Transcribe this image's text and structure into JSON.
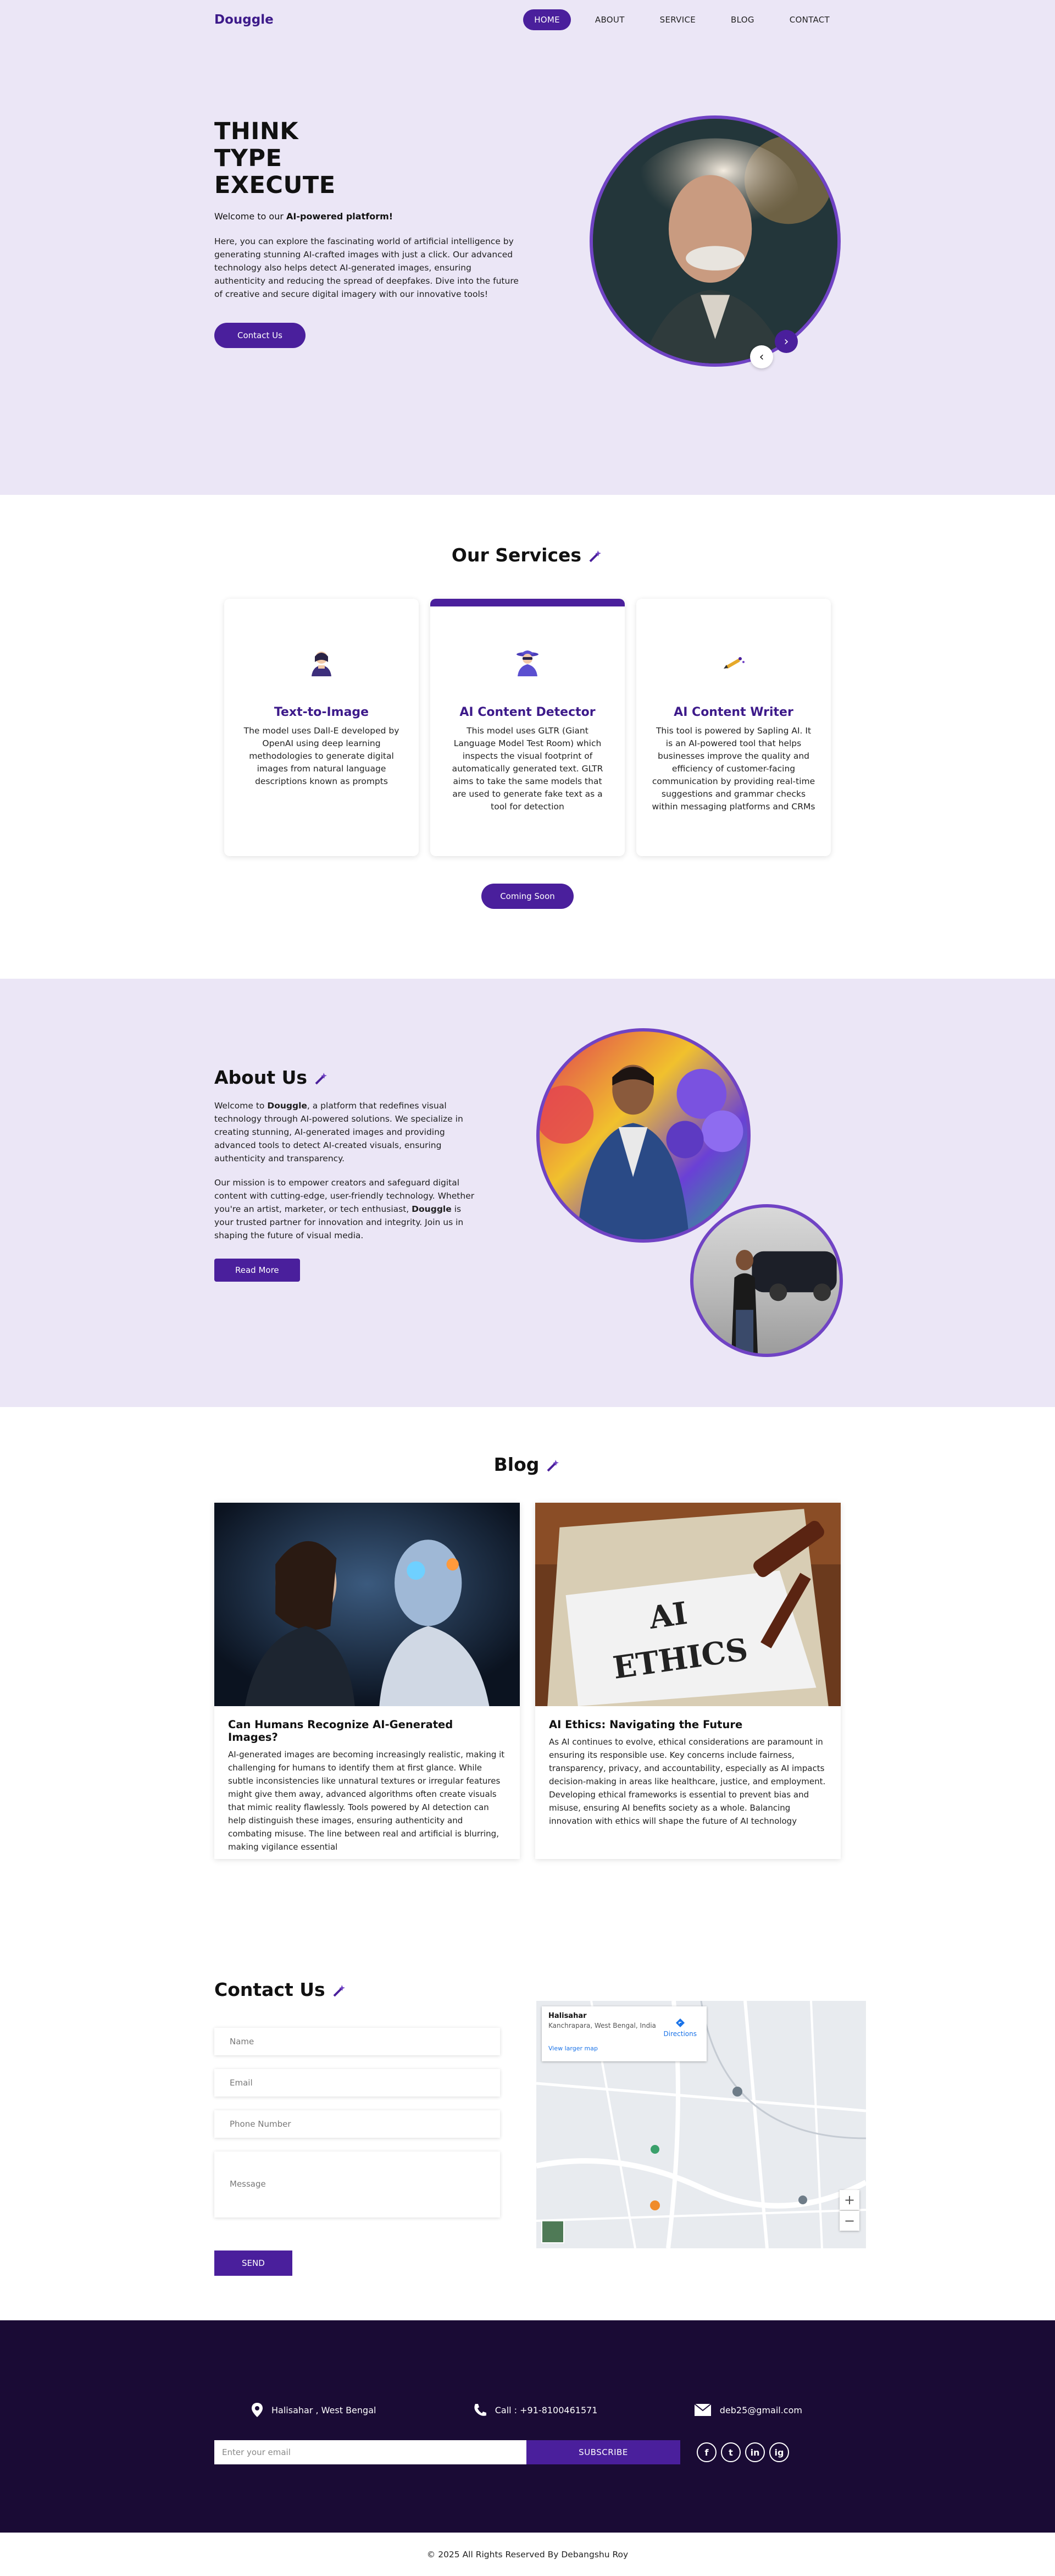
{
  "brand": "Douggle",
  "nav": {
    "items": [
      "HOME",
      "ABOUT",
      "SERVICE",
      "BLOG",
      "CONTACT"
    ],
    "active": "HOME"
  },
  "hero": {
    "title_line1": "THINK",
    "title_line2": "TYPE",
    "title_line3": "EXECUTE",
    "welcome_prefix": "Welcome to our",
    "welcome_bold": "AI-powered platform!",
    "description": "Here, you can explore the fascinating world of artificial intelligence by generating stunning AI-crafted images with just a click. Our advanced technology also helps detect AI-generated images, ensuring authenticity and reducing the spread of deepfakes. Dive into the future of creative and secure digital imagery with our innovative tools!",
    "cta": "Contact Us",
    "prev_glyph": "‹",
    "next_glyph": "›"
  },
  "services": {
    "title": "Our Services",
    "cards": [
      {
        "title": "Text-to-Image",
        "desc": "The model uses Dall-E developed by OpenAI using deep learning methodologies to generate digital images from natural language descriptions known as prompts"
      },
      {
        "title": "AI Content Detector",
        "desc": "This model uses GLTR (Giant Language Model Test Room) which inspects the visual footprint of automatically generated text. GLTR aims to take the same models that are used to generate fake text as a tool for detection"
      },
      {
        "title": "AI Content Writer",
        "desc": "This tool is powered by Sapling AI. It is an AI-powered tool that helps businesses improve the quality and efficiency of customer-facing communication by providing real-time suggestions and grammar checks within messaging platforms and CRMs"
      }
    ],
    "button": "Coming Soon"
  },
  "about": {
    "title": "About Us",
    "p1_prefix": "Welcome to",
    "p1_bold": "Douggle",
    "p1_rest": ", a platform that redefines visual technology through AI-powered solutions. We specialize in creating stunning, AI-generated images and providing advanced tools to detect AI-created visuals, ensuring authenticity and transparency.",
    "p2_start": "Our mission is to empower creators and safeguard digital content with cutting-edge, user-friendly technology. Whether you're an artist, marketer, or tech enthusiast,",
    "p2_bold": "Douggle",
    "p2_rest": "is your trusted partner for innovation and integrity. Join us in shaping the future of visual media.",
    "button": "Read More"
  },
  "blog": {
    "title": "Blog",
    "posts": [
      {
        "title": "Can Humans Recognize AI-Generated Images?",
        "text": "AI-generated images are becoming increasingly realistic, making it challenging for humans to identify them at first glance. While subtle inconsistencies like unnatural textures or irregular features might give them away, advanced algorithms often create visuals that mimic reality flawlessly. Tools powered by AI detection can help distinguish these images, ensuring authenticity and combating misuse. The line between real and artificial is blurring, making vigilance essential"
      },
      {
        "title": "AI Ethics: Navigating the Future",
        "text": "As AI continues to evolve, ethical considerations are paramount in ensuring its responsible use. Key concerns include fairness, transparency, privacy, and accountability, especially as AI impacts decision-making in areas like healthcare, justice, and employment. Developing ethical frameworks is essential to prevent bias and misuse, ensuring AI benefits society as a whole. Balancing innovation with ethics will shape the future of AI technology",
        "img_text_1": "AI",
        "img_text_2": "ETHICS"
      }
    ]
  },
  "contact": {
    "title": "Contact Us",
    "name_placeholder": "Name",
    "email_placeholder": "Email",
    "phone_placeholder": "Phone Number",
    "message_placeholder": "Message",
    "button": "SEND",
    "map": {
      "place": "Halisahar",
      "address": "Kanchrapara, West Bengal, India",
      "directions": "Directions",
      "larger_map": "View larger map"
    }
  },
  "footer": {
    "location": "Halisahar , West Bengal",
    "phone": "Call : +91-8100461571",
    "email": "deb25@gmail.com",
    "subscribe_placeholder": "Enter your email",
    "subscribe_button": "SUBSCRIBE",
    "socials": [
      "f",
      "t",
      "in",
      "ig"
    ],
    "copyright": "© 2025 All Rights Reserved By Debangshu Roy"
  },
  "colors": {
    "primary": "#4a1f9c",
    "hero_bg": "#ebe6f6",
    "footer_bg": "#1a0b35"
  }
}
